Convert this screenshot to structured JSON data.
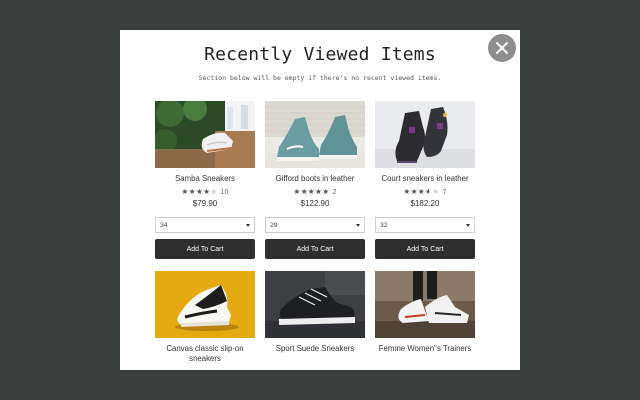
{
  "modal": {
    "title": "Recently Viewed Items",
    "subtitle": "Section below will be empty if there's no recent viewed items."
  },
  "close_icon": "close-icon",
  "products": [
    {
      "name": "Samba Sneakers",
      "rating": 4,
      "reviews": "10",
      "price": "$79.90",
      "size": "34",
      "cart_label": "Add To Cart"
    },
    {
      "name": "Gifford boots in leather",
      "rating": 5,
      "reviews": "2",
      "price": "$122.90",
      "size": "29",
      "cart_label": "Add To Cart"
    },
    {
      "name": "Court sneakers in leather",
      "rating": 3.5,
      "reviews": "7",
      "price": "$182.20",
      "size": "32",
      "cart_label": "Add To Cart"
    },
    {
      "name": "Canvas classic slip-on sneakers"
    },
    {
      "name": "Sport Suede Sneakers"
    },
    {
      "name": "Femme Women''s Trainers"
    }
  ],
  "colors": {
    "background": "#3a3f3e",
    "button": "#2e2e2e",
    "close": "#8e8e8e"
  }
}
